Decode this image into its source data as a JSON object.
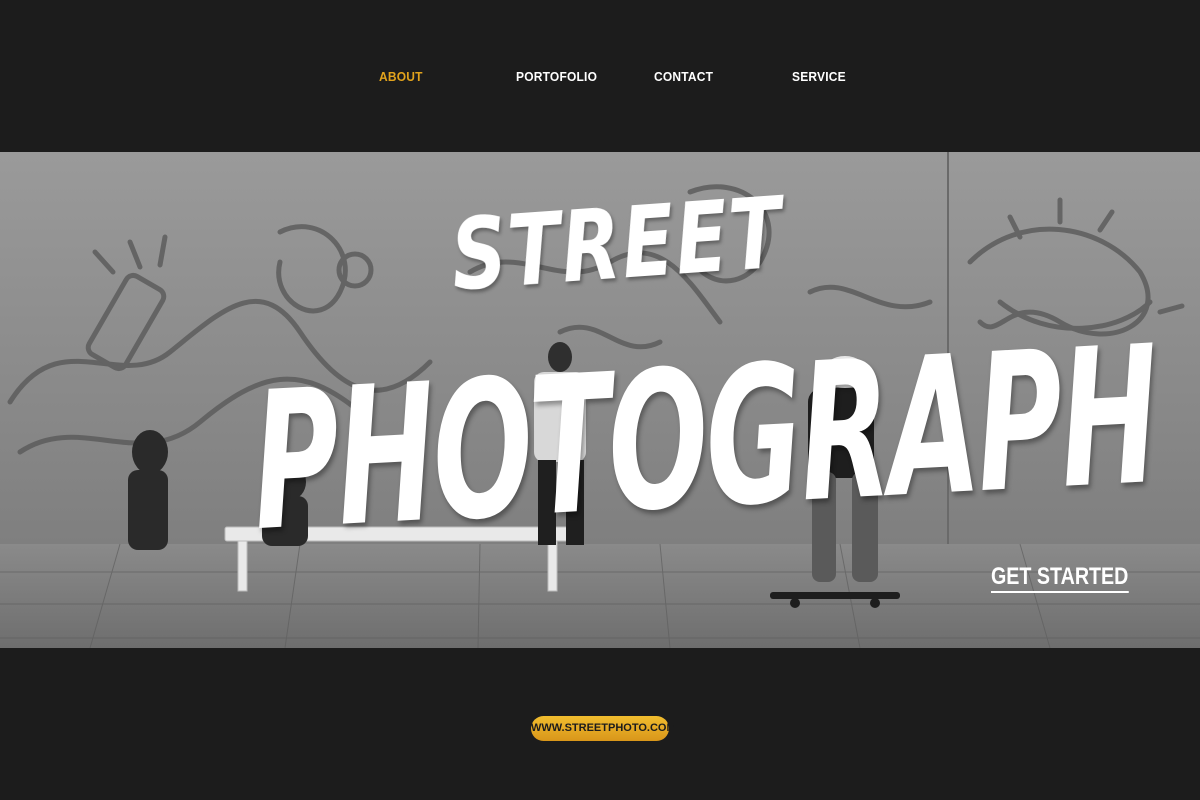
{
  "nav": {
    "items": [
      {
        "label": "ABOUT",
        "active": true
      },
      {
        "label": "PORTOFOLIO",
        "active": false
      },
      {
        "label": "CONTACT",
        "active": false
      },
      {
        "label": "SERVICE",
        "active": false
      }
    ],
    "active_color": "#e2a31c",
    "text_color": "#ffffff"
  },
  "hero": {
    "title_line1": "STREET",
    "title_line2": "PHOTOGRAPH",
    "cta_label": "GET STARTED",
    "photo_style": "black-and-white street photo with graffiti wall, skateboarder, bench"
  },
  "footer": {
    "url": "WWW.STREETPHOTO.COM",
    "pill_color": "#e9ad24"
  },
  "colors": {
    "background": "#1c1c1c",
    "accent": "#e2a31c"
  }
}
